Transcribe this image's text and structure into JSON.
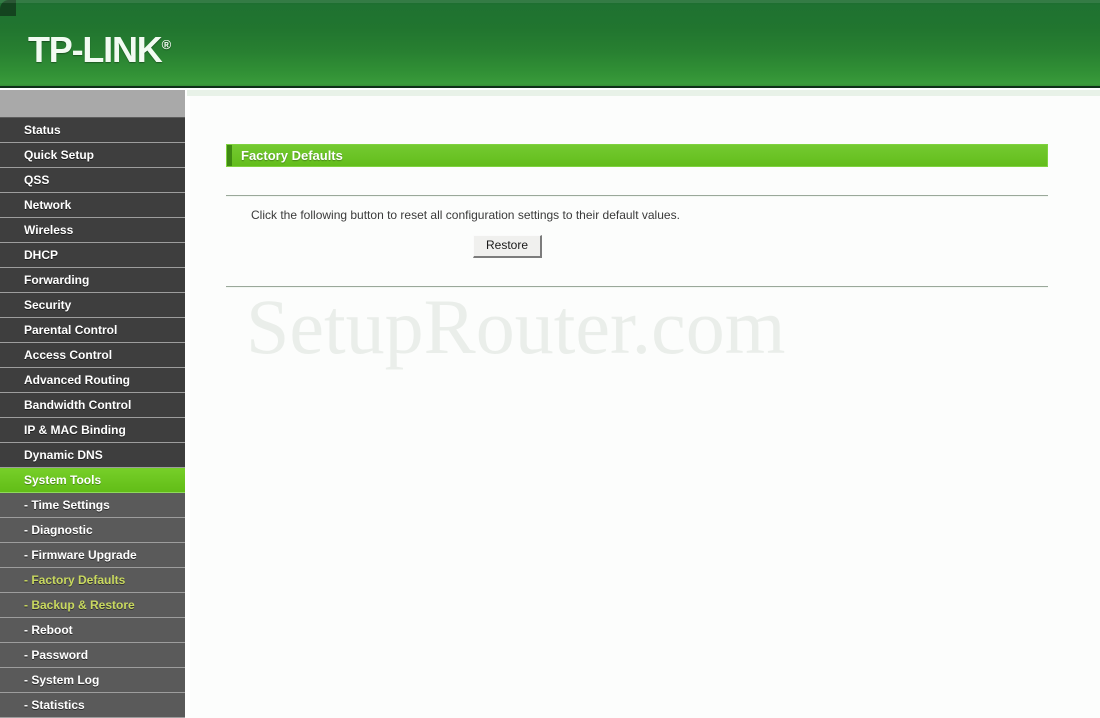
{
  "header": {
    "brand": "TP-LINK",
    "trademark": "®"
  },
  "sidebar": {
    "items": [
      {
        "label": "Status",
        "type": "top",
        "state": "normal"
      },
      {
        "label": "Quick Setup",
        "type": "top",
        "state": "normal"
      },
      {
        "label": "QSS",
        "type": "top",
        "state": "normal"
      },
      {
        "label": "Network",
        "type": "top",
        "state": "normal"
      },
      {
        "label": "Wireless",
        "type": "top",
        "state": "normal"
      },
      {
        "label": "DHCP",
        "type": "top",
        "state": "normal"
      },
      {
        "label": "Forwarding",
        "type": "top",
        "state": "normal"
      },
      {
        "label": "Security",
        "type": "top",
        "state": "normal"
      },
      {
        "label": "Parental Control",
        "type": "top",
        "state": "normal"
      },
      {
        "label": "Access Control",
        "type": "top",
        "state": "normal"
      },
      {
        "label": "Advanced Routing",
        "type": "top",
        "state": "normal"
      },
      {
        "label": "Bandwidth Control",
        "type": "top",
        "state": "normal"
      },
      {
        "label": "IP & MAC Binding",
        "type": "top",
        "state": "normal"
      },
      {
        "label": "Dynamic DNS",
        "type": "top",
        "state": "normal"
      },
      {
        "label": "System Tools",
        "type": "top",
        "state": "active"
      },
      {
        "label": "- Time Settings",
        "type": "sub",
        "state": "normal"
      },
      {
        "label": "- Diagnostic",
        "type": "sub",
        "state": "normal"
      },
      {
        "label": "- Firmware Upgrade",
        "type": "sub",
        "state": "normal"
      },
      {
        "label": "- Factory Defaults",
        "type": "sub",
        "state": "selected"
      },
      {
        "label": "- Backup & Restore",
        "type": "sub",
        "state": "selected"
      },
      {
        "label": "- Reboot",
        "type": "sub",
        "state": "normal"
      },
      {
        "label": "- Password",
        "type": "sub",
        "state": "normal"
      },
      {
        "label": "- System Log",
        "type": "sub",
        "state": "normal"
      },
      {
        "label": "- Statistics",
        "type": "sub",
        "state": "normal"
      }
    ]
  },
  "main": {
    "page_title": "Factory Defaults",
    "description": "Click the following button to reset all configuration settings to their default values.",
    "restore_label": "Restore",
    "watermark": "SetupRouter.com"
  },
  "colors": {
    "header_green_dark": "#1d6b30",
    "header_green_light": "#3a9b3b",
    "accent_green": "#6ec72a",
    "accent_green_dark": "#3f8a12",
    "sidebar_bg": "#3e3e3e",
    "sidebar_sub_bg": "#5a5a5a",
    "selected_sub_text": "#c9d95f",
    "content_bg": "#fcfdfc",
    "watermark_gray": "#eaeeea"
  }
}
